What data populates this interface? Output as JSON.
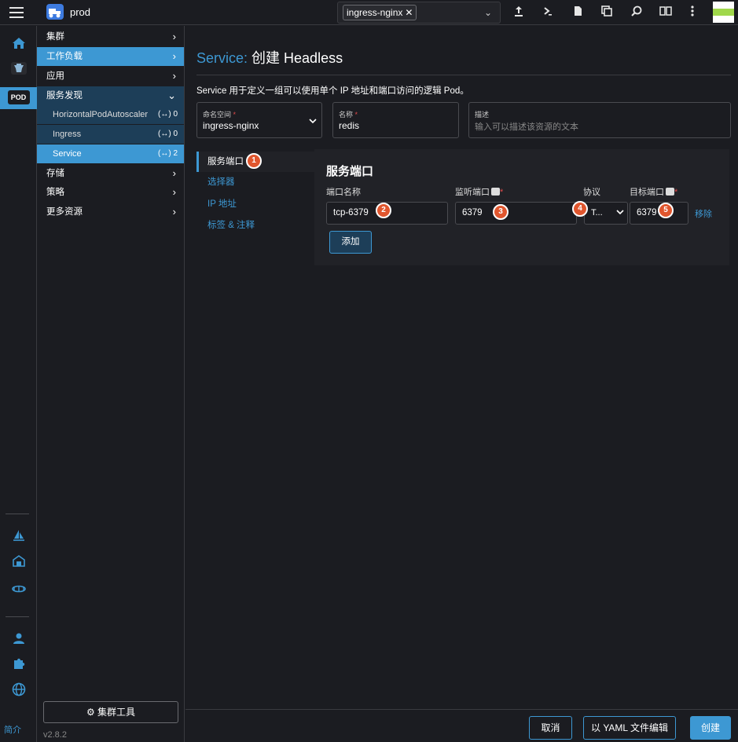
{
  "topbar": {
    "cluster_name": "prod",
    "namespace_tag": "ingress-nginx",
    "namespace_remove": "✕",
    "chevron": "⌄",
    "icons": [
      "upload-icon",
      "terminal-icon",
      "file-icon",
      "copy-icon",
      "search-icon",
      "book-icon",
      "more-vert-icon"
    ]
  },
  "rail": {
    "footer_label": "简介",
    "pod_label": "POD"
  },
  "sidenav": {
    "items": [
      {
        "label": "集群",
        "chev": "›"
      },
      {
        "label": "工作负载",
        "chev": "›"
      },
      {
        "label": "应用",
        "chev": "›"
      },
      {
        "label": "服务发现",
        "chev": "⌄"
      }
    ],
    "sub_items": [
      {
        "label": "HorizontalPodAutoscaler",
        "count": "(↔) 0"
      },
      {
        "label": "Ingress",
        "count": "(↔) 0"
      },
      {
        "label": "Service",
        "count": "(↔) 2"
      }
    ],
    "more_items": [
      {
        "label": "存储",
        "chev": "›"
      },
      {
        "label": "策略",
        "chev": "›"
      },
      {
        "label": "更多资源",
        "chev": "›"
      }
    ],
    "tools_button": "⚙ 集群工具",
    "version": "v2.8.2"
  },
  "main": {
    "title_prefix": "Service:",
    "title": " 创建 Headless",
    "description": "Service 用于定义一组可以使用单个 IP 地址和端口访问的逻辑 Pod。",
    "namespace_field": {
      "label": "命名空间",
      "required": "*",
      "value": "ingress-nginx"
    },
    "name_field": {
      "label": "名称",
      "required": "*",
      "value": "redis"
    },
    "desc_field": {
      "label": "描述",
      "placeholder": "输入可以描述该资源的文本"
    },
    "tabs": [
      "服务端口",
      "选择器",
      "IP 地址",
      "标签 & 注释"
    ],
    "section_title": "服务端口",
    "columns": {
      "port_name": "端口名称",
      "listen_port": "监听端口",
      "protocol": "协议",
      "target_port": "目标端口",
      "required": "*"
    },
    "row": {
      "port_name": "tcp-6379",
      "listen_port": "6379",
      "protocol": "T...",
      "target_port": "6379",
      "remove": "移除"
    },
    "add_button": "添加",
    "badges": [
      "1",
      "2",
      "3",
      "4",
      "5"
    ]
  },
  "footer": {
    "cancel": "取消",
    "yaml": "以 YAML 文件编辑",
    "create": "创建"
  },
  "colors": {
    "accent": "#3d98d3",
    "badge": "#e0562e",
    "background": "#1b1c21"
  }
}
